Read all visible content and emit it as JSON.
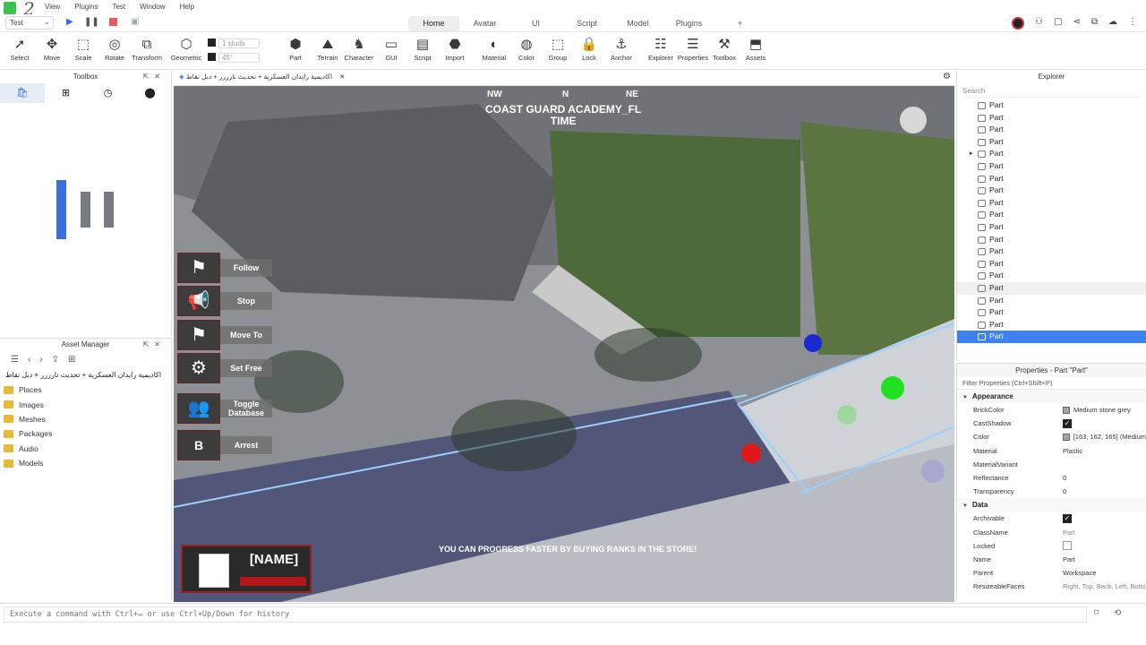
{
  "menubar": {
    "logo_num": "2",
    "items": [
      "View",
      "Plugins",
      "Test",
      "Window",
      "Help"
    ]
  },
  "tabrow": {
    "place": "Test",
    "tabs": [
      "Home",
      "Avatar",
      "UI",
      "Script",
      "Model",
      "Plugins",
      "+"
    ]
  },
  "ribbon": {
    "tools": [
      {
        "label": "Select",
        "icon": "cursor-icon"
      },
      {
        "label": "Move",
        "icon": "move-icon"
      },
      {
        "label": "Scale",
        "icon": "scale-icon"
      },
      {
        "label": "Rotate",
        "icon": "rotate-icon"
      },
      {
        "label": "Transform",
        "icon": "transform-icon"
      },
      {
        "label": "Geometric",
        "icon": "geometric-icon"
      },
      {
        "label": "Part",
        "icon": "part-icon"
      },
      {
        "label": "Terrain",
        "icon": "terrain-icon"
      },
      {
        "label": "Character",
        "icon": "character-icon"
      },
      {
        "label": "GUI",
        "icon": "gui-icon"
      },
      {
        "label": "Script",
        "icon": "script-icon"
      },
      {
        "label": "Import",
        "icon": "import-icon"
      },
      {
        "label": "Material",
        "icon": "material-icon"
      },
      {
        "label": "Color",
        "icon": "color-icon"
      },
      {
        "label": "Group",
        "icon": "group-icon"
      },
      {
        "label": "Lock",
        "icon": "lock-icon"
      },
      {
        "label": "Anchor",
        "icon": "anchor-icon"
      },
      {
        "label": "Explorer",
        "icon": "explorer-icon"
      },
      {
        "label": "Properties",
        "icon": "properties-icon"
      },
      {
        "label": "Toolbox",
        "icon": "toolbox-icon"
      },
      {
        "label": "Assets",
        "icon": "assets-icon"
      }
    ],
    "move_snap": "1 studs",
    "rotate_snap": "45°"
  },
  "toolbox": {
    "title": "Toolbox"
  },
  "asset_manager": {
    "title": "Asset Manager",
    "place_name": "اكاديمية رايدان العسكرية + تحديث نارررر + دبل نقاط",
    "folders": [
      "Places",
      "Images",
      "Meshes",
      "Packages",
      "Audio",
      "Models"
    ]
  },
  "viewport": {
    "tab_title": "اكاديمية رايدان العسكرية + تحديث نارررر + دبل نقاط",
    "compass": [
      "NW",
      "N",
      "NE"
    ],
    "title_line1": "COAST GUARD ACADEMY_FL",
    "title_line2": "TIME",
    "hud_buttons": [
      {
        "label": "Follow",
        "icon": "flag-icon"
      },
      {
        "label": "Stop",
        "icon": "megaphone-icon"
      },
      {
        "label": "Move To",
        "icon": "move-to-icon"
      },
      {
        "label": "Set Free",
        "icon": "gear-icon"
      },
      {
        "label": "Toggle Database",
        "icon": "people-icon"
      },
      {
        "label": "Arrest",
        "icon": "b-icon"
      }
    ],
    "b_letter": "B",
    "player_name": "[NAME]",
    "store_message": "YOU CAN PROGRESS FASTER BY BUYING RANKS IN THE STORE!"
  },
  "explorer": {
    "title": "Explorer",
    "search_placeholder": "Search",
    "items": [
      "Part",
      "Part",
      "Part",
      "Part",
      "Part",
      "Part",
      "Part",
      "Part",
      "Part",
      "Part",
      "Part",
      "Part",
      "Part",
      "Part",
      "Part",
      "Part",
      "Part",
      "Part",
      "Part",
      "Part"
    ]
  },
  "properties": {
    "title": "Properties - Part \"Part\"",
    "filter": "Filter Properties (Ctrl+Shift+P)",
    "appearance_label": "Appearance",
    "data_label": "Data",
    "appearance": [
      {
        "name": "BrickColor",
        "value": "Medium stone grey",
        "kind": "swatch"
      },
      {
        "name": "CastShadow",
        "value": "",
        "kind": "check-on"
      },
      {
        "name": "Color",
        "value": "[163, 162, 165] (Medium",
        "kind": "swatch"
      },
      {
        "name": "Material",
        "value": "Plastic",
        "kind": "text"
      },
      {
        "name": "MaterialVariant",
        "value": "",
        "kind": "text"
      },
      {
        "name": "Reflectance",
        "value": "0",
        "kind": "text"
      },
      {
        "name": "Transparency",
        "value": "0",
        "kind": "text"
      }
    ],
    "data": [
      {
        "name": "Archivable",
        "value": "",
        "kind": "check-on"
      },
      {
        "name": "ClassName",
        "value": "Part",
        "kind": "dim"
      },
      {
        "name": "Locked",
        "value": "",
        "kind": "check-off"
      },
      {
        "name": "Name",
        "value": "Part",
        "kind": "text"
      },
      {
        "name": "Parent",
        "value": "Workspace",
        "kind": "text"
      },
      {
        "name": "ResizeableFaces",
        "value": "Right, Top, Back, Left, Botto",
        "kind": "dim"
      }
    ]
  },
  "command_bar": {
    "placeholder": "Execute a command with Ctrl+↵ or use Ctrl+Up/Down for history"
  }
}
